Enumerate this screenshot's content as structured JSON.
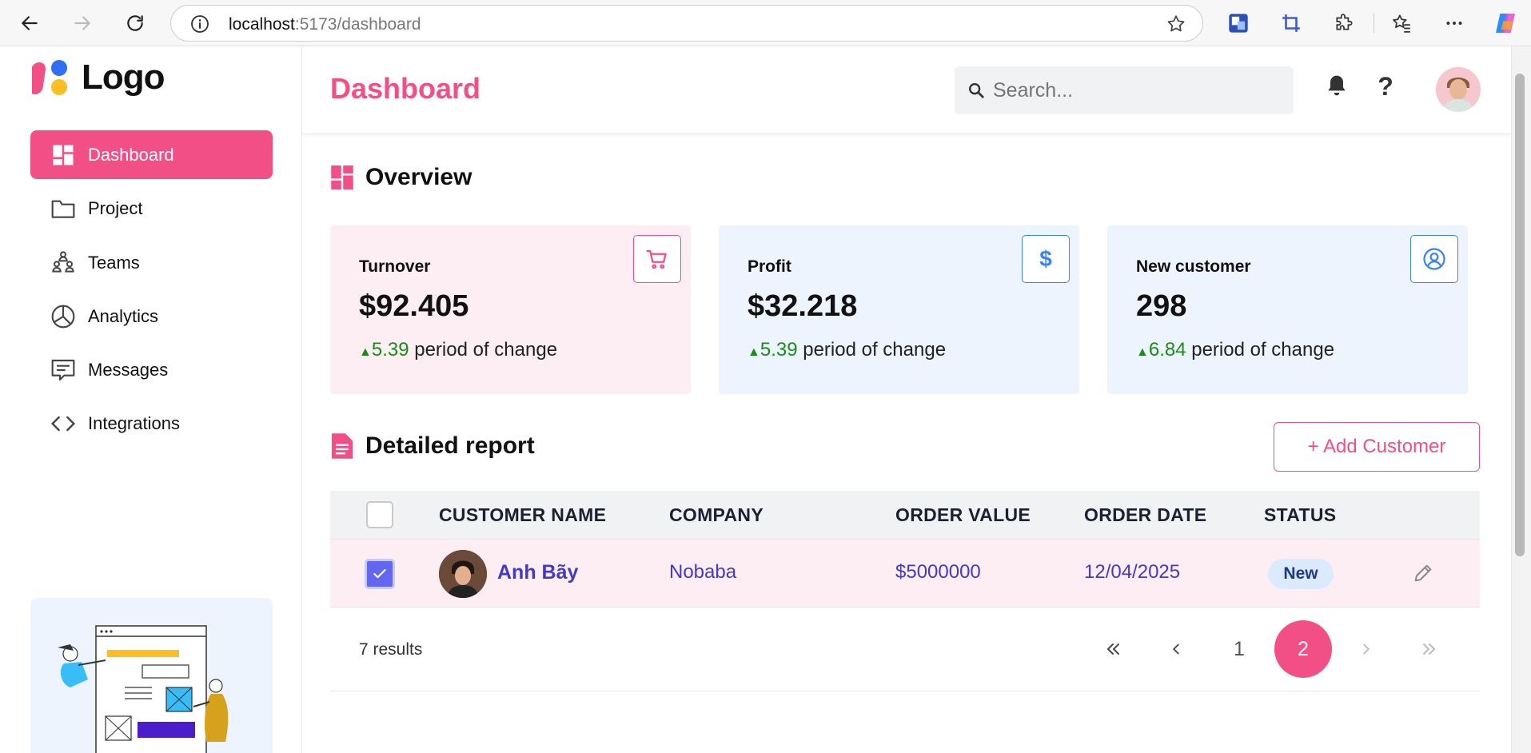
{
  "browser": {
    "url_host": "localhost",
    "url_path": ":5173/dashboard"
  },
  "sidebar": {
    "logo_text": "Logo",
    "items": [
      {
        "label": "Dashboard",
        "icon": "dashboard-icon",
        "active": true
      },
      {
        "label": "Project",
        "icon": "folder-icon"
      },
      {
        "label": "Teams",
        "icon": "teams-icon"
      },
      {
        "label": "Analytics",
        "icon": "pie-chart-icon"
      },
      {
        "label": "Messages",
        "icon": "message-icon"
      },
      {
        "label": "Integrations",
        "icon": "code-icon"
      }
    ]
  },
  "header": {
    "title": "Dashboard",
    "search_placeholder": "Search...",
    "help_label": "?"
  },
  "overview": {
    "title": "Overview",
    "cards": [
      {
        "label": "Turnover",
        "value": "$92.405",
        "change": "5.39",
        "change_text": "period of change",
        "icon": "cart-icon",
        "bg": "#fdeef3",
        "accent": "#f24f86"
      },
      {
        "label": "Profit",
        "value": "$32.218",
        "change": "5.39",
        "change_text": "period of change",
        "icon": "dollar-icon",
        "bg": "#eef4fd",
        "accent": "#3b82f6"
      },
      {
        "label": "New customer",
        "value": "298",
        "change": "6.84",
        "change_text": "period of change",
        "icon": "user-circle-icon",
        "bg": "#eef4fd",
        "accent": "#3b82f6"
      }
    ]
  },
  "report": {
    "title": "Detailed report",
    "add_button": "+ Add Customer",
    "columns": [
      "CUSTOMER NAME",
      "COMPANY",
      "ORDER VALUE",
      "ORDER DATE",
      "STATUS"
    ],
    "rows": [
      {
        "name": "Anh Bãy",
        "company": "Nobaba",
        "order_value": "$5000000",
        "order_date": "12/04/2025",
        "status": "New",
        "checked": true
      }
    ],
    "results": "7 results",
    "pagination": {
      "pages": [
        "1",
        "2"
      ],
      "current": "2"
    }
  },
  "colors": {
    "brand": "#f24f86",
    "link": "#4338ca",
    "positive": "#1a8c1a"
  }
}
